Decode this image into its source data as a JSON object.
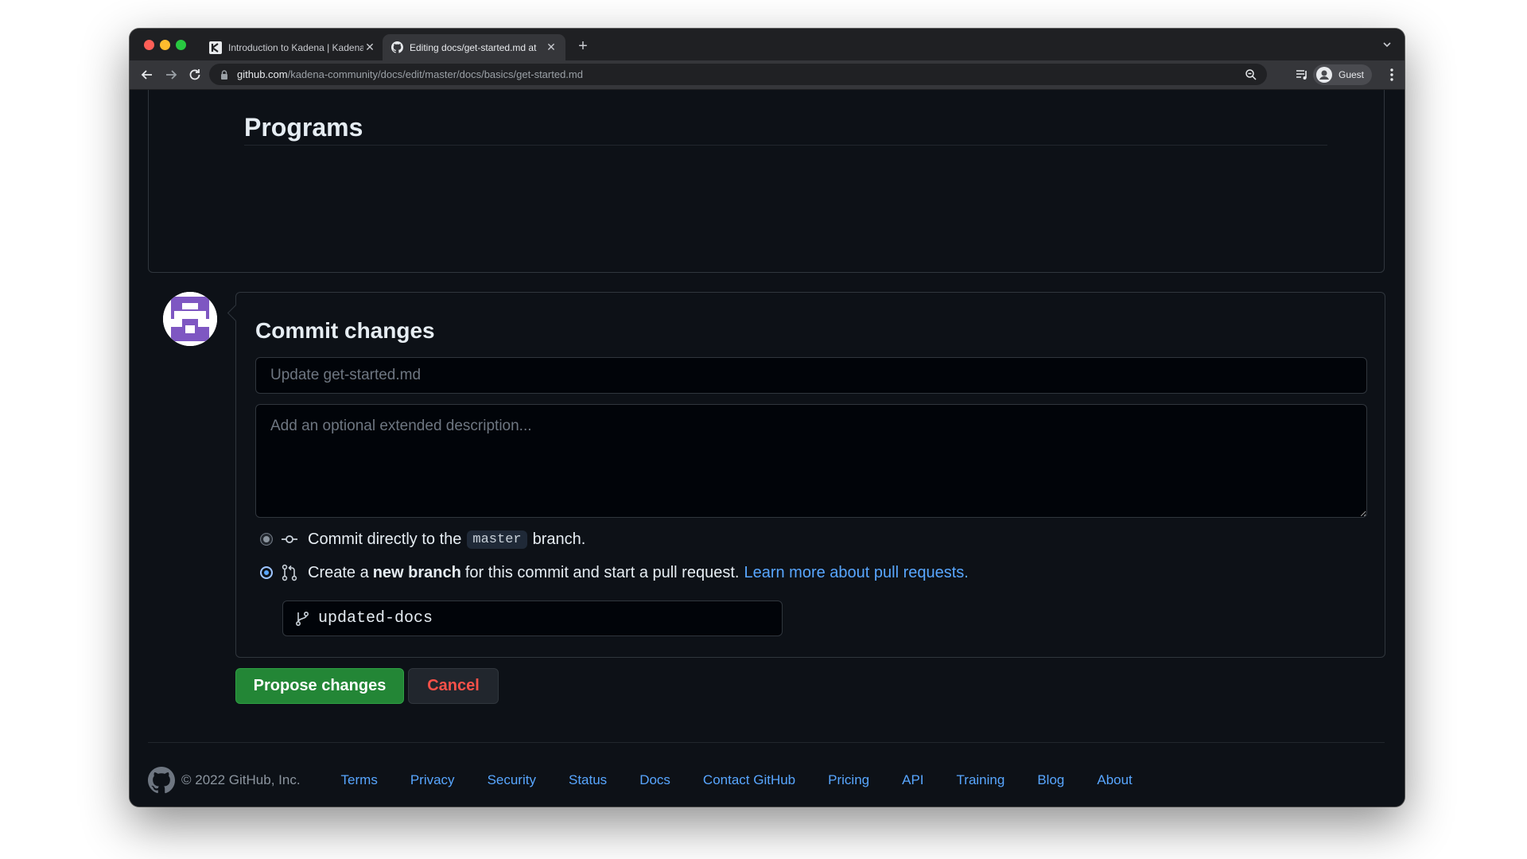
{
  "browser": {
    "tabs": [
      {
        "title": "Introduction to Kadena | Kadena"
      },
      {
        "title": "Editing docs/get-started.md at"
      }
    ],
    "url_host": "github.com",
    "url_path": "/kadena-community/docs/edit/master/docs/basics/get-started.md",
    "profile_label": "Guest"
  },
  "preview": {
    "heading": "Programs"
  },
  "commit": {
    "title": "Commit changes",
    "summary_placeholder": "Update get-started.md",
    "description_placeholder": "Add an optional extended description...",
    "option_direct": {
      "prefix": "Commit directly to the",
      "branch": "master",
      "suffix": "branch."
    },
    "option_new_branch": {
      "prefix": "Create a",
      "bold": "new branch",
      "suffix": "for this commit and start a pull request.",
      "link": "Learn more about pull requests."
    },
    "selected_option": "new_branch",
    "branch_name": "updated-docs",
    "propose_label": "Propose changes",
    "cancel_label": "Cancel"
  },
  "footer": {
    "copyright": "© 2022 GitHub, Inc.",
    "links": [
      "Terms",
      "Privacy",
      "Security",
      "Status",
      "Docs",
      "Contact GitHub",
      "Pricing",
      "API",
      "Training",
      "Blog",
      "About"
    ]
  },
  "colors": {
    "page_bg": "#0d1117",
    "accent_link": "#58a6ff",
    "propose_button": "#238636",
    "cancel_text": "#f85149"
  },
  "icons": [
    "kadena-favicon-icon",
    "github-favicon-icon",
    "tab-close-icon",
    "new-tab-icon",
    "tab-search-icon",
    "back-arrow-icon",
    "forward-arrow-icon",
    "reload-icon",
    "lock-icon",
    "zoom-icon",
    "media-control-icon",
    "guest-profile-icon",
    "kebab-menu-icon",
    "commit-icon",
    "pull-request-icon",
    "branch-icon",
    "github-mark-icon"
  ]
}
